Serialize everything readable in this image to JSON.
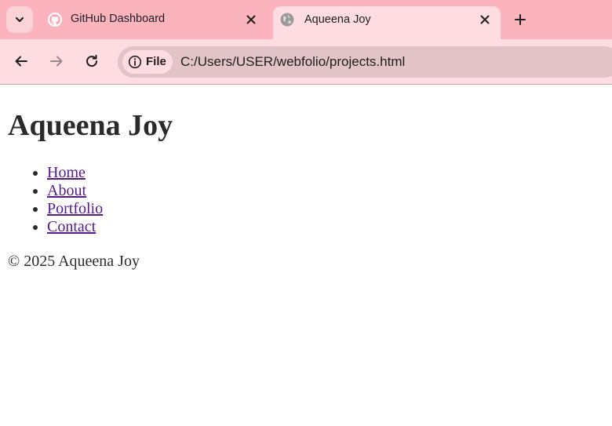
{
  "browser": {
    "tabs": [
      {
        "title": "GitHub Dashboard",
        "favicon": "github-icon",
        "active": false
      },
      {
        "title": "Aqueena Joy",
        "favicon": "globe-icon",
        "active": true
      }
    ],
    "address_bar": {
      "security_label": "File",
      "url": "C:/Users/USER/webfolio/projects.html"
    },
    "colors": {
      "tabstrip_bg": "#fbb3be",
      "toolbar_bg": "#fedce2",
      "omnibox_bg": "#e1c3c8"
    }
  },
  "page": {
    "heading": "Aqueena Joy",
    "nav": [
      "Home",
      "About",
      "Portfolio",
      "Contact"
    ],
    "footer": "© 2025 Aqueena Joy",
    "link_color": "#551a8b"
  }
}
